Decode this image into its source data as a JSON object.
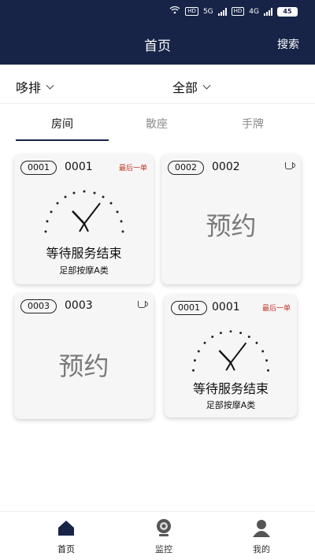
{
  "header": {
    "title": "首页",
    "search_label": "搜索",
    "status": {
      "hd1": "HD",
      "net1": "5G",
      "hd2": "HD",
      "net2": "4G",
      "battery": "45"
    }
  },
  "filters": {
    "left": "哆排",
    "right": "全部"
  },
  "tabs": [
    {
      "label": "房间",
      "active": true
    },
    {
      "label": "散座",
      "active": false
    },
    {
      "label": "手牌",
      "active": false
    }
  ],
  "cards": [
    {
      "pill": "0001",
      "number": "0001",
      "tag": "最后一单",
      "status": "等待服务结束",
      "service": "足部按摩A类"
    },
    {
      "pill": "0002",
      "number": "0002",
      "status": "预约",
      "icon": "cup-icon"
    },
    {
      "pill": "0003",
      "number": "0003",
      "status": "预约",
      "icon": "cup-icon"
    },
    {
      "pill": "0001",
      "number": "0001",
      "tag": "最后一单",
      "status": "等待服务结束",
      "service": "足部按摩A类"
    }
  ],
  "tabbar": [
    {
      "label": "首页",
      "icon": "home-icon",
      "active": true
    },
    {
      "label": "监控",
      "icon": "camera-icon",
      "active": false
    },
    {
      "label": "我的",
      "icon": "user-icon",
      "active": false
    }
  ],
  "colors": {
    "header": "#172447",
    "accent": "#c0392b"
  }
}
